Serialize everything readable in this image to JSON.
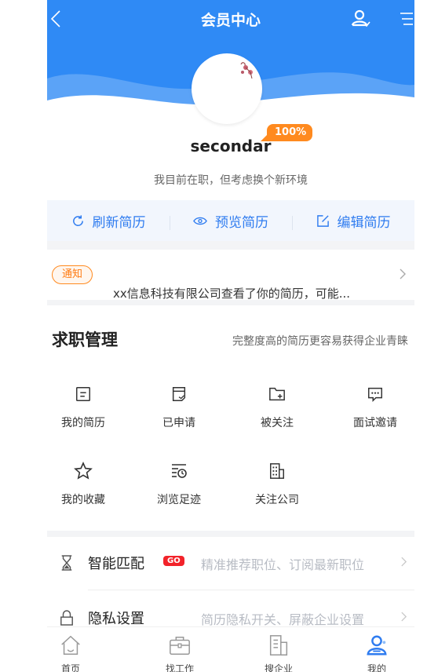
{
  "header": {
    "title": "会员中心",
    "username": "secondar",
    "completeness": "100%",
    "status": "我目前在职，但考虑换个新环境"
  },
  "actions": [
    {
      "label": "刷新简历",
      "icon": "refresh-icon"
    },
    {
      "label": "预览简历",
      "icon": "eye-icon"
    },
    {
      "label": "编辑简历",
      "icon": "edit-icon"
    }
  ],
  "notice": {
    "tag": "通知",
    "text": "xx信息科技有限公司查看了你的简历，可能..."
  },
  "job_management": {
    "title": "求职管理",
    "hint": "完整度高的简历更容易获得企业青睐",
    "items": [
      {
        "label": "我的简历",
        "icon": "resume-icon"
      },
      {
        "label": "已申请",
        "icon": "applied-icon"
      },
      {
        "label": "被关注",
        "icon": "followed-folder-icon"
      },
      {
        "label": "面试邀请",
        "icon": "interview-chat-icon"
      },
      {
        "label": "我的收藏",
        "icon": "star-icon"
      },
      {
        "label": "浏览足迹",
        "icon": "history-icon"
      },
      {
        "label": "关注公司",
        "icon": "building-icon"
      }
    ]
  },
  "list": [
    {
      "name": "智能匹配",
      "badge": "GO",
      "desc": "精准推荐职位、订阅最新职位",
      "icon": "hourglass-icon"
    },
    {
      "name": "隐私设置",
      "desc": "简历隐私开关、屏蔽企业设置",
      "icon": "lock-icon"
    }
  ],
  "tabs": [
    {
      "label": "首页",
      "icon": "home-icon"
    },
    {
      "label": "找工作",
      "icon": "briefcase-icon"
    },
    {
      "label": "搜企业",
      "icon": "company-icon"
    },
    {
      "label": "我的",
      "icon": "profile-icon",
      "active": true
    }
  ],
  "colors": {
    "primary": "#2f8af5",
    "accent_orange": "#ff8a1f",
    "go_red": "#f2232a"
  }
}
